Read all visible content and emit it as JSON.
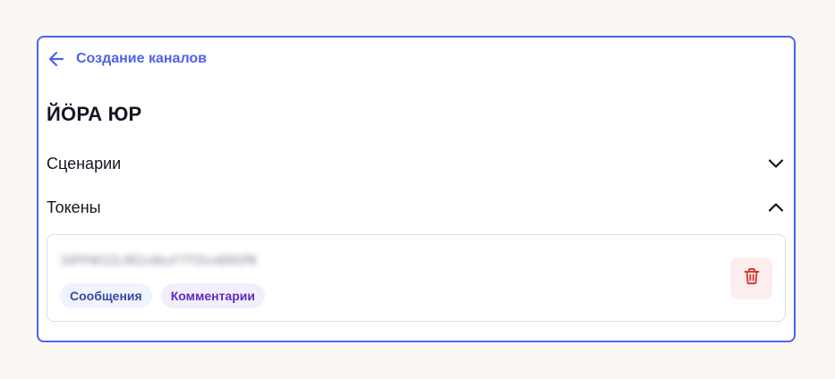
{
  "header": {
    "back_icon": "arrow-left-icon",
    "back_label": "Создание каналов"
  },
  "page": {
    "title": "ЙÖРА ЮР"
  },
  "sections": {
    "scenarios": {
      "label": "Сценарии",
      "expanded": false,
      "icon": "chevron-down-icon"
    },
    "tokens": {
      "label": "Токены",
      "expanded": true,
      "icon": "chevron-up-icon"
    }
  },
  "token": {
    "value": "1OFP4ESZLXR2s8bxF7T55s4ERSPB",
    "tags": [
      "Сообщения",
      "Комментарии"
    ],
    "delete_icon": "trash-icon"
  },
  "colors": {
    "accent": "#4f63e8",
    "text": "#151522",
    "danger": "#d93a34",
    "danger_bg": "#fdeeee",
    "tag_messages_bg": "#eef3fc",
    "tag_comments_bg": "#f3eefc",
    "page_bg": "#fbf8f4"
  }
}
